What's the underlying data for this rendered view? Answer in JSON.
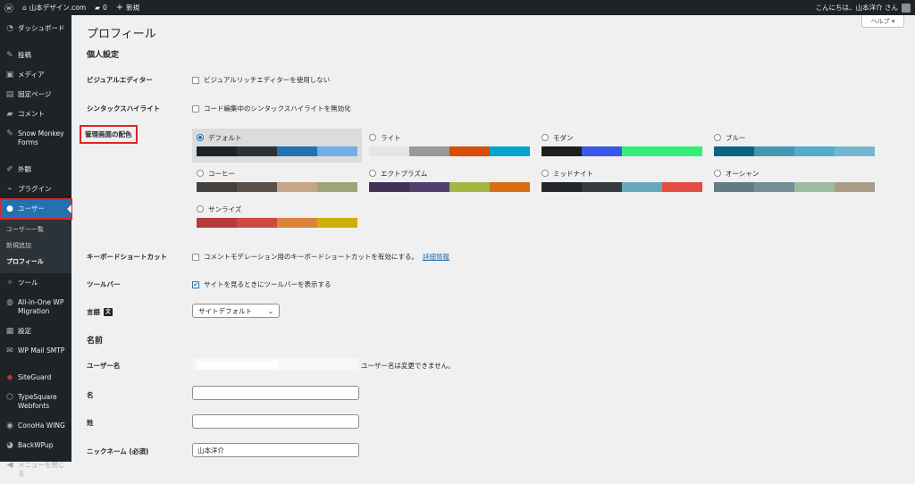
{
  "adminbar": {
    "site_name": "山本デザイン.com",
    "comments_count": "0",
    "new_label": "新規",
    "greeting": "こんにちは、山本洋介 さん"
  },
  "sidebar": {
    "items": [
      {
        "label": "ダッシュボード",
        "icon": "gauge-icon"
      },
      {
        "label": "投稿",
        "icon": "pin-icon"
      },
      {
        "label": "メディア",
        "icon": "media-icon"
      },
      {
        "label": "固定ページ",
        "icon": "page-icon"
      },
      {
        "label": "コメント",
        "icon": "comment-icon"
      },
      {
        "label": "Snow Monkey Forms",
        "icon": "pin-icon"
      },
      {
        "label": "外観",
        "icon": "brush-icon"
      },
      {
        "label": "プラグイン",
        "icon": "plug-icon"
      },
      {
        "label": "ユーザー",
        "icon": "user-icon"
      },
      {
        "label": "ツール",
        "icon": "wrench-icon"
      },
      {
        "label": "All-in-One WP Migration",
        "icon": "migration-icon"
      },
      {
        "label": "設定",
        "icon": "settings-icon"
      },
      {
        "label": "WP Mail SMTP",
        "icon": "mail-icon"
      },
      {
        "label": "SiteGuard",
        "icon": "guard-icon"
      },
      {
        "label": "TypeSquare Webfonts",
        "icon": "font-icon"
      },
      {
        "label": "ConoHa WING",
        "icon": "conoha-icon"
      },
      {
        "label": "BackWPup",
        "icon": "backup-icon"
      },
      {
        "label": "メニューを閉じる",
        "icon": "collapse-icon"
      }
    ],
    "submenu": [
      "ユーザー一覧",
      "新規追加",
      "プロフィール"
    ]
  },
  "main": {
    "help_label": "ヘルプ ▾",
    "page_title": "プロフィール",
    "section_personal": "個人設定",
    "visual_editor": {
      "label": "ビジュアルエディター",
      "option": "ビジュアルリッチエディターを使用しない"
    },
    "syntax_highlight": {
      "label": "シンタックスハイライト",
      "option": "コード編集中のシンタックスハイライトを無効化"
    },
    "color_scheme_label": "管理画面の配色",
    "schemes": [
      {
        "name": "デフォルト",
        "colors": [
          "#1d2327",
          "#2c3338",
          "#2271b1",
          "#72aee6"
        ],
        "selected": true
      },
      {
        "name": "ライト",
        "colors": [
          "#e5e5e5",
          "#999999",
          "#d64e07",
          "#04a4cc"
        ],
        "selected": false
      },
      {
        "name": "モダン",
        "colors": [
          "#1e1e1e",
          "#3858e9",
          "#33f078",
          "#33f078"
        ],
        "selected": false
      },
      {
        "name": "ブルー",
        "colors": [
          "#096484",
          "#4796b3",
          "#52accc",
          "#74b6ce"
        ],
        "selected": false
      },
      {
        "name": "コーヒー",
        "colors": [
          "#46403c",
          "#59524c",
          "#c7a589",
          "#9ea476"
        ],
        "selected": false
      },
      {
        "name": "エクトプラズム",
        "colors": [
          "#413256",
          "#523f6d",
          "#a3b745",
          "#d46f15"
        ],
        "selected": false
      },
      {
        "name": "ミッドナイト",
        "colors": [
          "#25282b",
          "#363b3f",
          "#69a8bb",
          "#e14d43"
        ],
        "selected": false
      },
      {
        "name": "オーシャン",
        "colors": [
          "#627c83",
          "#738e96",
          "#9ebaa0",
          "#aa9d88"
        ],
        "selected": false
      },
      {
        "name": "サンライズ",
        "colors": [
          "#b43c38",
          "#cf4944",
          "#dd823b",
          "#ccaf0b"
        ],
        "selected": false
      }
    ],
    "keyboard": {
      "label": "キーボードショートカット",
      "option": "コメントモデレーション用のキーボードショートカットを有効にする。",
      "link": "詳細情報"
    },
    "toolbar": {
      "label": "ツールバー",
      "option": "サイトを見るときにツールバーを表示する"
    },
    "language": {
      "label": "言語",
      "value": "サイトデフォルト"
    },
    "section_name": "名前",
    "username": {
      "label": "ユーザー名",
      "note": "ユーザー名は変更できません。"
    },
    "first_name": {
      "label": "名",
      "value": ""
    },
    "last_name": {
      "label": "姓",
      "value": ""
    },
    "nickname": {
      "label": "ニックネーム (必須)",
      "value": "山本洋介"
    }
  }
}
